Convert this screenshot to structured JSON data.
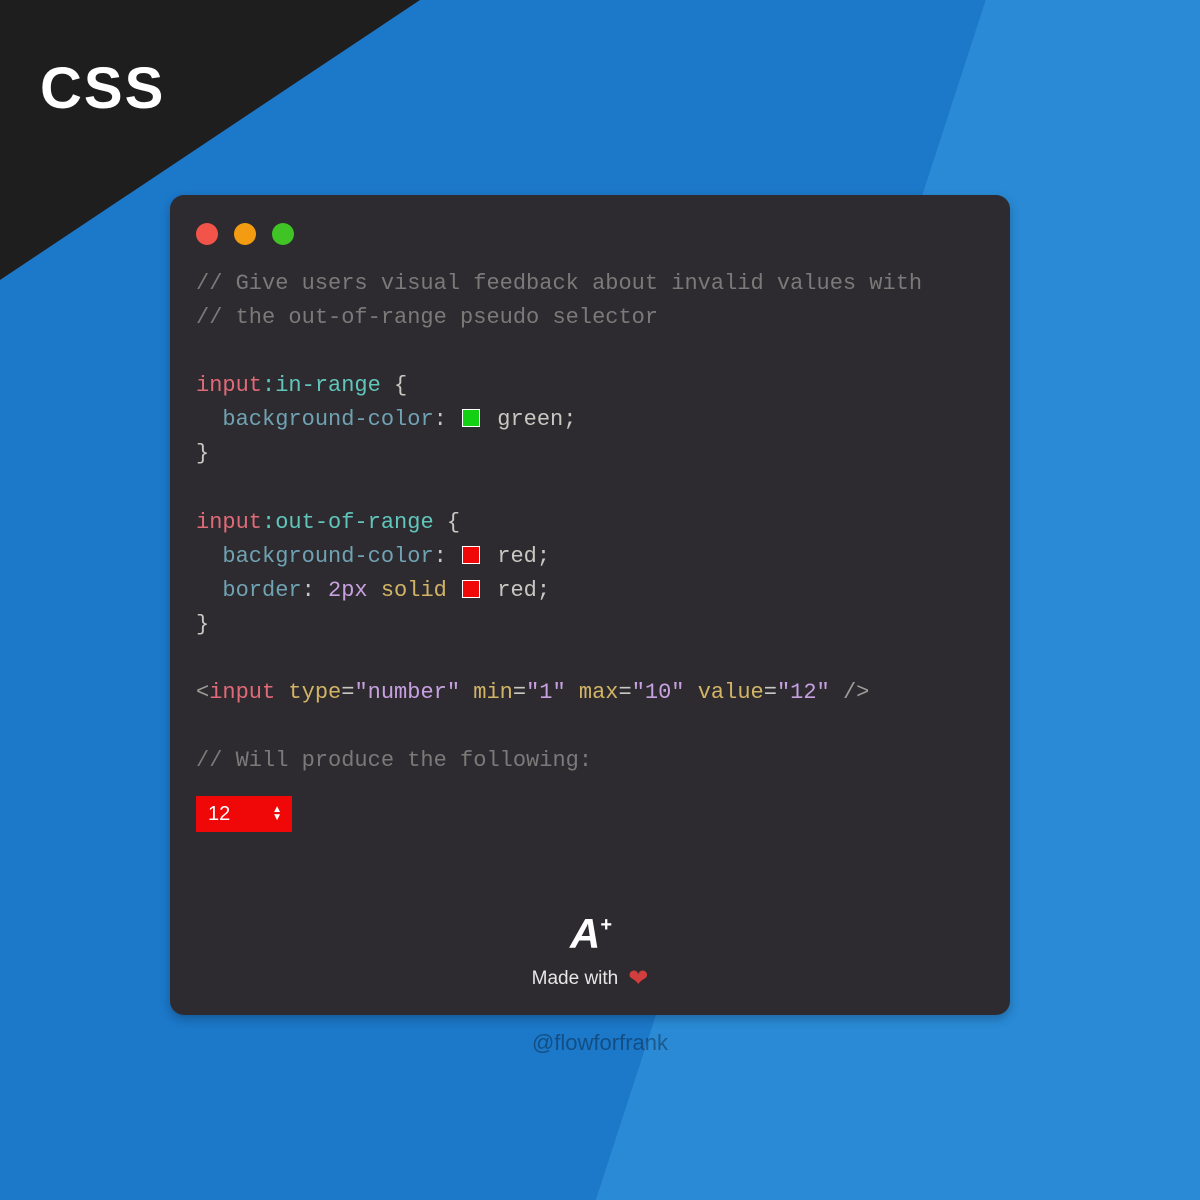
{
  "corner_label": "CSS",
  "code": {
    "comment1": "// Give users visual feedback about invalid values with",
    "comment2": "// the out-of-range pseudo selector",
    "rule1": {
      "selector": "input",
      "pseudo": ":in-range",
      "open": " {",
      "prop1": "background-color",
      "val1": "green",
      "swatch1": "#14d014",
      "close": "}"
    },
    "rule2": {
      "selector": "input",
      "pseudo": ":out-of-range",
      "open": " {",
      "prop1": "background-color",
      "val1": "red",
      "prop2": "border",
      "val2_size": "2px",
      "val2_style": "solid",
      "val2_color": "red",
      "swatch": "#f00808",
      "close": "}"
    },
    "html_tag": {
      "open": "<",
      "name": "input",
      "attr1": "type",
      "val1": "\"number\"",
      "attr2": "min",
      "val2": "\"1\"",
      "attr3": "max",
      "val3": "\"10\"",
      "attr4": "value",
      "val4": "\"12\"",
      "close": " />"
    },
    "comment3": "// Will produce the following:"
  },
  "demo": {
    "value": "12"
  },
  "footer": {
    "logo_letter": "A",
    "logo_plus": "+",
    "made_text": "Made with",
    "heart": "❤"
  },
  "handle": "@flowforfrank"
}
